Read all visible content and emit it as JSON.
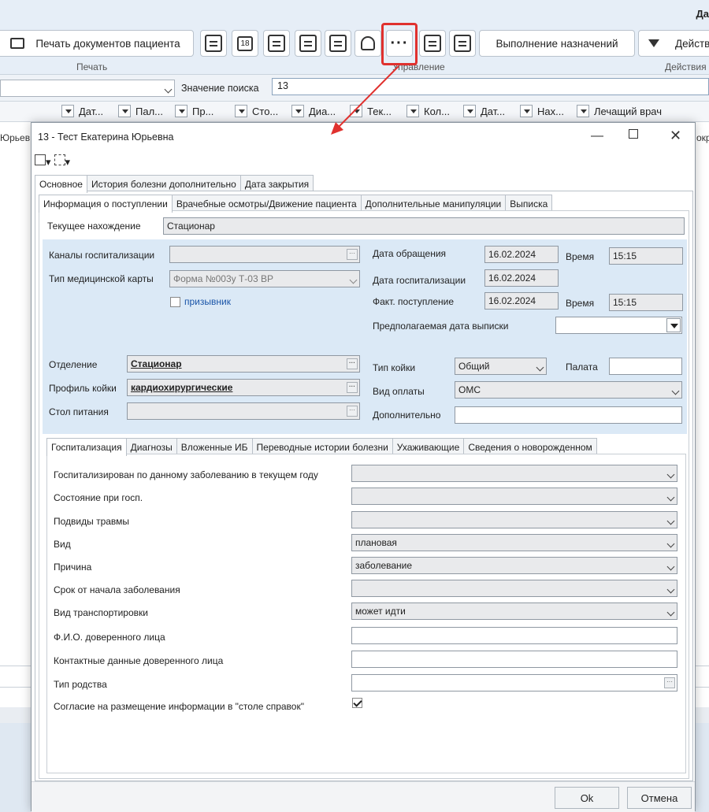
{
  "app": {
    "corner_title": "Да",
    "ribbon": {
      "print_button": "Печать документов пациента",
      "print_group": "Печать",
      "manage_group": "Управление",
      "execute_button": "Выполнение назначений",
      "actions_button": "Действ",
      "actions_group": "Действия"
    },
    "search": {
      "label": "Значение поиска",
      "value": "13"
    },
    "columns": [
      "Дат...",
      "Пал...",
      "Пр...",
      "Сто...",
      "Диа...",
      "Тек...",
      "Кол...",
      "Дат...",
      "Нах...",
      "Лечащий врач"
    ],
    "list_left_cut": "Юрьев",
    "list_right_cut": "окр"
  },
  "dialog": {
    "title": "13 - Тест Екатерина Юрьевна",
    "top_tabs": [
      "Основное",
      "История болезни дополнительно",
      "Дата закрытия"
    ],
    "sub_tabs": [
      "Информация о поступлении",
      "Врачебные осмотры/Движение пациента",
      "Дополнительные манипуляции",
      "Выписка"
    ],
    "current_location": {
      "label": "Текущее нахождение",
      "value": "Стационар"
    },
    "left": {
      "channels": {
        "label": "Каналы госпитализации",
        "value": ""
      },
      "card_type": {
        "label": "Тип медицинской карты",
        "value": "Форма №003у Т-03 ВР"
      },
      "conscript": {
        "label": "призывник"
      },
      "department": {
        "label": "Отделение",
        "value": "Стационар"
      },
      "bed_profile": {
        "label": "Профиль койки",
        "value": "кардиохирургические"
      },
      "diet": {
        "label": "Стол питания",
        "value": ""
      }
    },
    "right": {
      "appeal_date": {
        "label": "Дата обращения",
        "value": "16.02.2024"
      },
      "time_label": "Время",
      "appeal_time": "15:15",
      "hosp_date": {
        "label": "Дата госпитализации",
        "value": "16.02.2024"
      },
      "actual_arrival": {
        "label": "Факт. поступление",
        "value": "16.02.2024"
      },
      "arrival_time": "15:15",
      "expected_discharge": {
        "label": "Предполагаемая дата выписки",
        "value": ""
      },
      "bed_type": {
        "label": "Тип койки",
        "value": "Общий"
      },
      "ward": {
        "label": "Палата",
        "value": ""
      },
      "payment": {
        "label": "Вид оплаты",
        "value": "ОМС"
      },
      "additional": {
        "label": "Дополнительно",
        "value": ""
      }
    },
    "lower_tabs": [
      "Госпитализация",
      "Диагнозы",
      "Вложенные ИБ",
      "Переводные истории болезни",
      "Ухаживающие",
      "Сведения о новорожденном"
    ],
    "hosp_fields": [
      {
        "label": "Госпитализирован по данному заболеванию в текущем году",
        "value": "",
        "kind": "combo"
      },
      {
        "label": "Состояние при госп.",
        "value": "",
        "kind": "combo"
      },
      {
        "label": "Подвиды травмы",
        "value": "",
        "kind": "combo"
      },
      {
        "label": "Вид",
        "value": "плановая",
        "kind": "combo"
      },
      {
        "label": "Причина",
        "value": "заболевание",
        "kind": "combo"
      },
      {
        "label": "Срок от начала заболевания",
        "value": "",
        "kind": "combo"
      },
      {
        "label": "Вид транспортировки",
        "value": "может идти",
        "kind": "combo"
      },
      {
        "label": "Ф.И.О. доверенного лица",
        "value": "",
        "kind": "text"
      },
      {
        "label": "Контактные данные доверенного лица",
        "value": "",
        "kind": "text"
      },
      {
        "label": "Тип родства",
        "value": "",
        "kind": "lookup"
      }
    ],
    "consent": {
      "label": "Согласие на размещение информации в \"столе справок\"",
      "checked": true
    },
    "ok_button": "Ok",
    "cancel_button": "Отмена"
  },
  "colors": {
    "highlight": "#e0312e",
    "blue_area": "#dbe9f6"
  }
}
